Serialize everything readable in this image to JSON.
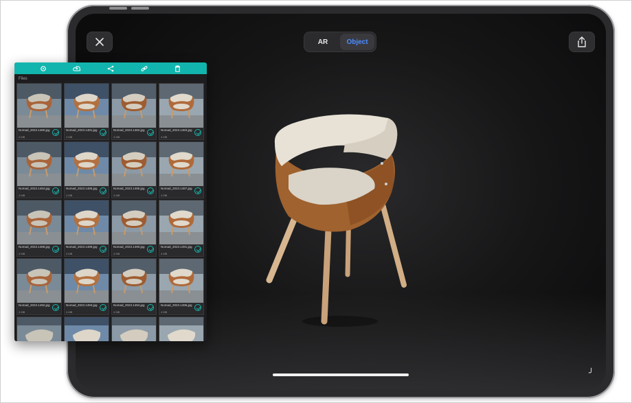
{
  "viewer": {
    "mode_tabs": [
      {
        "label": "AR",
        "active": false
      },
      {
        "label": "Object",
        "active": true
      }
    ],
    "close_icon": "close-icon",
    "share_icon": "share-icon"
  },
  "panel": {
    "toolbar_icons": [
      "settings-icon",
      "cloud-upload-icon",
      "share-nodes-icon",
      "link-icon",
      "trash-icon"
    ],
    "accent_color": "#12b5ad",
    "section_label": "Files",
    "files": [
      {
        "name": "Nomad_2023.1480.jpg",
        "size": "4 MB"
      },
      {
        "name": "Nomad_2023.1481.jpg",
        "size": "4 MB"
      },
      {
        "name": "Nomad_2023.1482.jpg",
        "size": "4 MB"
      },
      {
        "name": "Nomad_2023.1483.jpg",
        "size": "4 MB"
      },
      {
        "name": "Nomad_2023.1484.jpg",
        "size": "4 MB"
      },
      {
        "name": "Nomad_2023.1485.jpg",
        "size": "4 MB"
      },
      {
        "name": "Nomad_2023.1486.jpg",
        "size": "4 MB"
      },
      {
        "name": "Nomad_2023.1487.jpg",
        "size": "4 MB"
      },
      {
        "name": "Nomad_2023.1488.jpg",
        "size": "4 MB"
      },
      {
        "name": "Nomad_2023.1489.jpg",
        "size": "4 MB"
      },
      {
        "name": "Nomad_2023.1490.jpg",
        "size": "4 MB"
      },
      {
        "name": "Nomad_2023.1491.jpg",
        "size": "4 MB"
      },
      {
        "name": "Nomad_2023.1492.jpg",
        "size": "4 MB"
      },
      {
        "name": "Nomad_2023.1493.jpg",
        "size": "4 MB"
      },
      {
        "name": "Nomad_2023.1494.jpg",
        "size": "4 MB"
      },
      {
        "name": "Nomad_2023.1495.jpg",
        "size": "4 MB"
      }
    ]
  }
}
